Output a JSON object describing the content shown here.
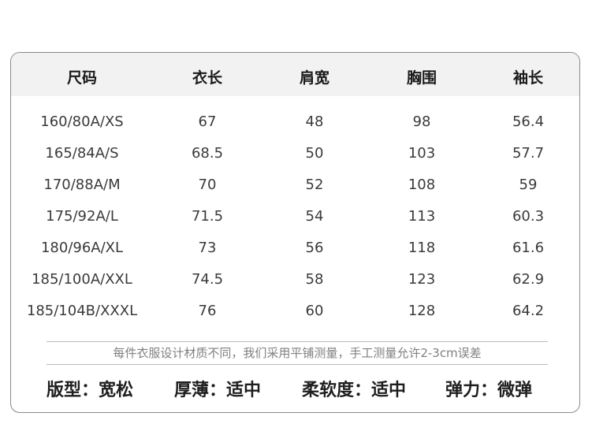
{
  "headers": [
    "尺码",
    "衣长",
    "肩宽",
    "胸围",
    "袖长"
  ],
  "rows": [
    [
      "160/80A/XS",
      "67",
      "48",
      "98",
      "56.4"
    ],
    [
      "165/84A/S",
      "68.5",
      "50",
      "103",
      "57.7"
    ],
    [
      "170/88A/M",
      "70",
      "52",
      "108",
      "59"
    ],
    [
      "175/92A/L",
      "71.5",
      "54",
      "113",
      "60.3"
    ],
    [
      "180/96A/XL",
      "73",
      "56",
      "118",
      "61.6"
    ],
    [
      "185/100A/XXL",
      "74.5",
      "58",
      "123",
      "62.9"
    ],
    [
      "185/104B/XXXL",
      "76",
      "60",
      "128",
      "64.2"
    ]
  ],
  "note": "每件衣服设计材质不同，我们采用平铺测量，手工测量允许2-3cm误差",
  "features": [
    "版型：宽松",
    "厚薄：适中",
    "柔软度：适中",
    "弹力：微弹"
  ]
}
